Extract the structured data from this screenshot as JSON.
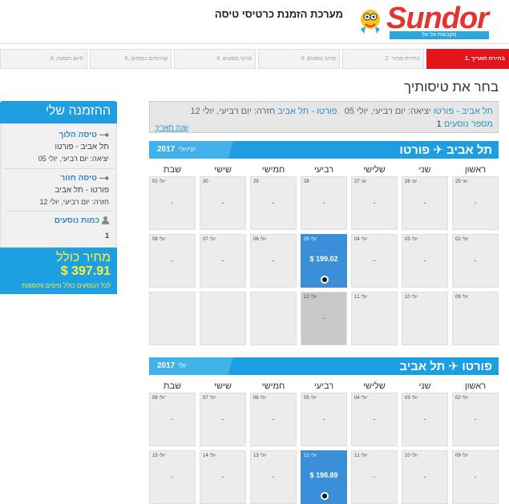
{
  "header": {
    "site_title": "מערכת הזמנת כרטיסי טיסה",
    "logo_text": "Sundor",
    "logo_tagline": "מקבוצת אל על"
  },
  "steps": [
    {
      "label": "1. בחירת תאריך",
      "active": true
    },
    {
      "label": "2. בחירת מחיר",
      "active": false
    },
    {
      "label": "3. פרטי נוסעים",
      "active": false
    },
    {
      "label": "4. פרטי נוסעים",
      "active": false
    },
    {
      "label": "5. שירותים נוספים",
      "active": false
    },
    {
      "label": "6. סיום הזמנה",
      "active": false
    }
  ],
  "main": {
    "heading": "בחר את טיסותיך"
  },
  "summary": {
    "outbound_route": "תל אביב - פורטו",
    "outbound_text": "יציאה: יום רביעי, יולי 05",
    "return_route": "פורטו - תל אביב",
    "return_text": "חזרה: יום רביעי, יולי 12",
    "passengers_label": "מספר נוסעים",
    "passengers_count": "1",
    "change_date": "שנה תאריך"
  },
  "calendars": [
    {
      "route": "תל אביב ✈ פורטו",
      "month": "2017",
      "month_sub": "יוני/יולי",
      "day_names": [
        "ראשון",
        "שני",
        "שלישי",
        "רביעי",
        "חמישי",
        "שישי",
        "שבת"
      ],
      "rows": [
        [
          {
            "day": "25 יוני",
            "text": "-"
          },
          {
            "day": "26 יוני",
            "text": "-"
          },
          {
            "day": "27 יוני",
            "text": "-"
          },
          {
            "day": "28",
            "text": "-"
          },
          {
            "day": "29",
            "text": "-"
          },
          {
            "day": "30",
            "text": "-"
          },
          {
            "day": "01 יולי",
            "text": "-"
          }
        ],
        [
          {
            "day": "02 יולי",
            "text": "-"
          },
          {
            "day": "03 יולי",
            "text": "-"
          },
          {
            "day": "04 יולי",
            "text": "-"
          },
          {
            "day": "05 יולי",
            "text": "$ 199.02",
            "selected": true
          },
          {
            "day": "06 יולי",
            "text": "-"
          },
          {
            "day": "07 יולי",
            "text": "-"
          },
          {
            "day": "08 יולי",
            "text": "-"
          }
        ],
        [
          {
            "day": "09 יולי",
            "text": ""
          },
          {
            "day": "10 יולי",
            "text": ""
          },
          {
            "day": "11 יולי",
            "text": ""
          },
          {
            "day": "12 יולי",
            "text": "-",
            "grey": true
          },
          {
            "day": "",
            "text": ""
          },
          {
            "day": "",
            "text": ""
          },
          {
            "day": "",
            "text": ""
          }
        ]
      ]
    },
    {
      "route": "פורטו ✈ תל אביב",
      "month": "2017",
      "month_sub": "יולי",
      "day_names": [
        "ראשון",
        "שני",
        "שלישי",
        "רביעי",
        "חמישי",
        "שישי",
        "שבת"
      ],
      "rows": [
        [
          {
            "day": "02 יולי",
            "text": "-"
          },
          {
            "day": "03 יולי",
            "text": "-"
          },
          {
            "day": "04 יולי",
            "text": "-"
          },
          {
            "day": "05 יולי",
            "text": "-"
          },
          {
            "day": "06 יולי",
            "text": "-"
          },
          {
            "day": "07 יולי",
            "text": "-"
          },
          {
            "day": "08 יולי",
            "text": "-"
          }
        ],
        [
          {
            "day": "09 יולי",
            "text": "-"
          },
          {
            "day": "10 יולי",
            "text": "-"
          },
          {
            "day": "11 יולי",
            "text": "-"
          },
          {
            "day": "12 יולי",
            "text": "$ 198.89",
            "selected": true
          },
          {
            "day": "13 יולי",
            "text": "-"
          },
          {
            "day": "14 יולי",
            "text": "-"
          },
          {
            "day": "15 יולי",
            "text": "-"
          }
        ]
      ]
    }
  ],
  "sidebar": {
    "title": "ההזמנה שלי",
    "outbound": {
      "title": "טיסה הלוך",
      "route": "תל אביב - פורטו",
      "date": "יציאה: יום רביעי, יולי 05"
    },
    "return": {
      "title": "טיסה חזור",
      "route": "פורטו - תל אביב",
      "date": "חזרה: יום רביעי, יולי 12"
    },
    "passengers": {
      "title": "כמות נוסעים",
      "count": "1"
    },
    "total": {
      "label": "מחיר כולל",
      "value": "$ 397.91",
      "note": "לכל הנוסעים כולל מיסים ותוספות"
    }
  }
}
